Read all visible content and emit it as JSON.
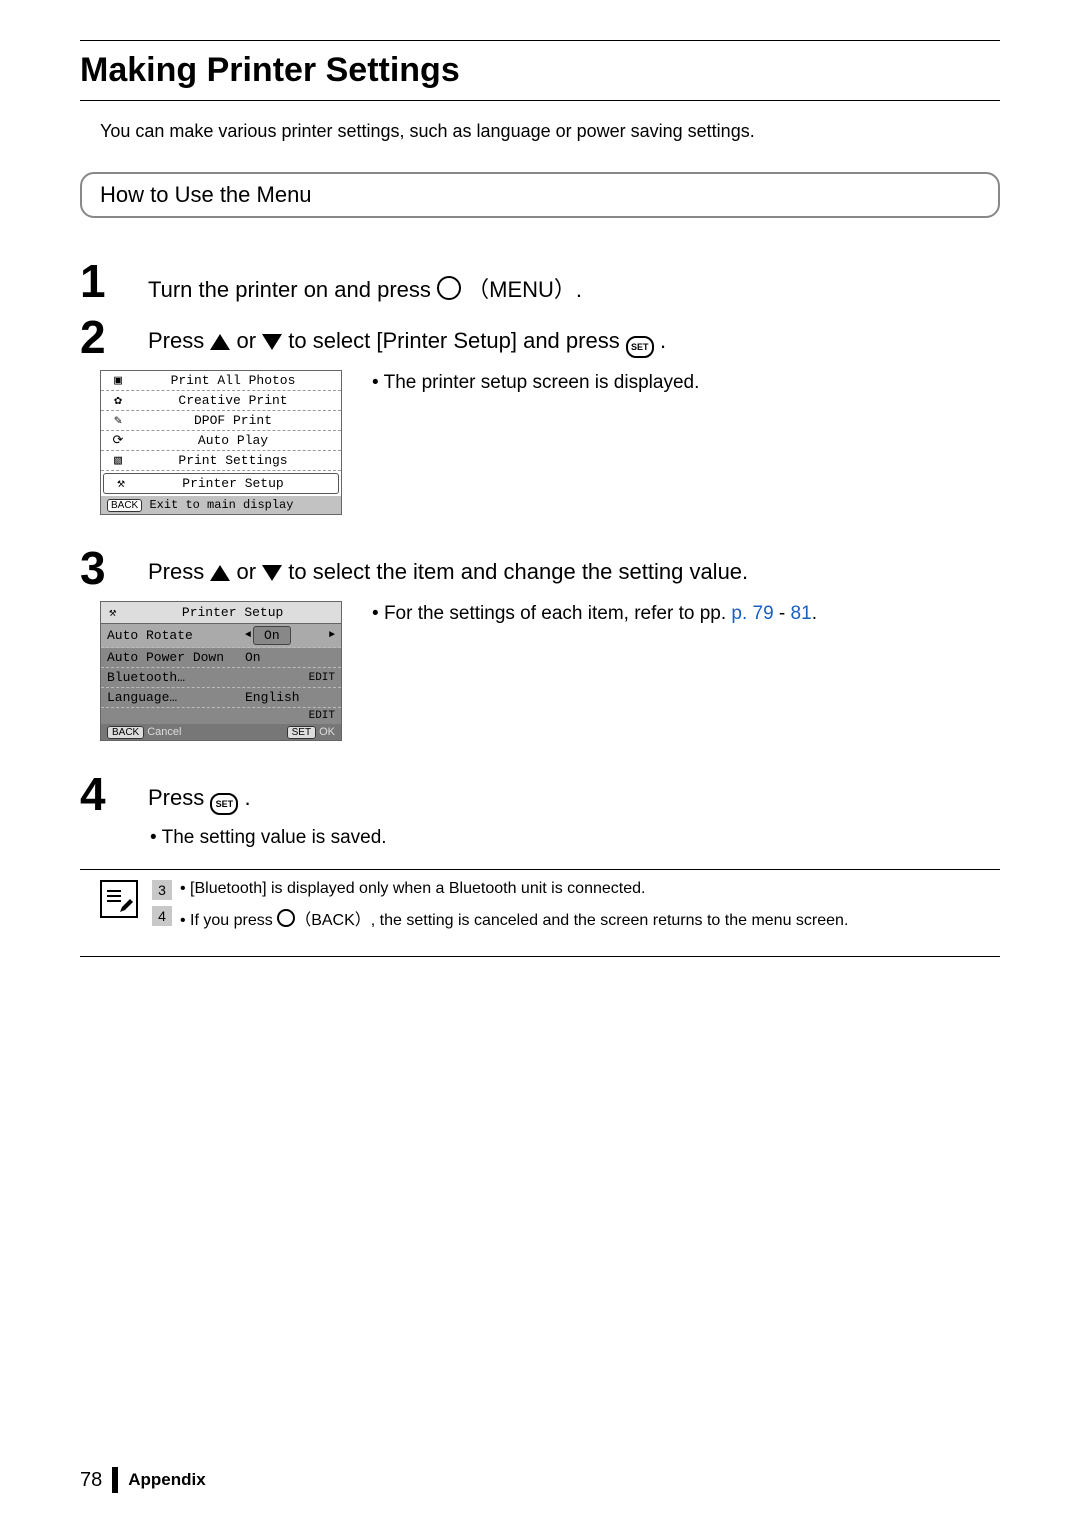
{
  "title": "Making Printer Settings",
  "intro": "You can make various printer settings, such as language or power saving settings.",
  "section_heading": "How to Use the Menu",
  "steps": {
    "s1": {
      "num": "1",
      "pre": "Turn the printer on and press ",
      "menu_label": "（MENU）",
      "post": "."
    },
    "s2": {
      "num": "2",
      "pre": "Press ",
      "mid1": " or ",
      "mid2": " to select [Printer Setup] and press ",
      "post": ".",
      "sub": "The printer setup screen is displayed."
    },
    "s3": {
      "num": "3",
      "pre": "Press ",
      "mid1": " or ",
      "mid2": " to select the item and change the setting value.",
      "sub_pre": "For the settings of each item, refer to pp. ",
      "link1": "p. 79",
      "dash": " - ",
      "link2": "81",
      "sub_post": "."
    },
    "s4": {
      "num": "4",
      "pre": "Press ",
      "post": ".",
      "sub": "The setting value is saved."
    }
  },
  "menu_screen": {
    "items": [
      "Print All Photos",
      "Creative Print",
      "DPOF Print",
      "Auto Play",
      "Print Settings",
      "Printer Setup"
    ],
    "back_label": "BACK",
    "bottom_text": "Exit to main display"
  },
  "settings_screen": {
    "title": "Printer Setup",
    "rows": [
      {
        "label": "Auto Rotate",
        "value": "On",
        "selected": true
      },
      {
        "label": "Auto Power Down",
        "value": "On"
      },
      {
        "label": "Bluetooth…",
        "value": "",
        "edit": "EDIT"
      },
      {
        "label": "Language…",
        "value": "English"
      }
    ],
    "edit_label": "EDIT",
    "bottom": {
      "back": "BACK",
      "cancel": "Cancel",
      "set": "SET",
      "ok": "OK"
    }
  },
  "notes": {
    "n3": {
      "num": "3",
      "text": "[Bluetooth] is displayed only when a Bluetooth unit is connected."
    },
    "n4": {
      "num": "4",
      "pre": "If you press ",
      "back_label": "（BACK）",
      "post": ", the setting is canceled and the screen returns to the menu screen."
    }
  },
  "footer": {
    "page": "78",
    "section": "Appendix"
  },
  "set_label": "SET"
}
